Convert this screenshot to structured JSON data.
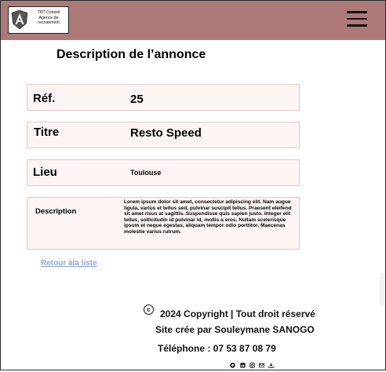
{
  "header": {
    "logo_text": "TRT Conseil Agence de recrutement"
  },
  "page_title": "Description de l’annonce",
  "details": {
    "ref_label": "Réf.",
    "ref_value": "25",
    "title_label": "Titre",
    "title_value": "Resto Speed",
    "location_label": "Lieu",
    "location_value": "Toulouse",
    "description_label": "Description",
    "description_value": "Lorem ipsum dolor sit amet, consectetur adipiscing elit. Nam augue  ligula, varius et tellus sed, pulvinar suscipit tellus. Praesent  eleifend sit amet risus at sagittis. Suspendisse quis sapien justo.  Integer elit tellus, sollicitudin id pulvinar id, mollis a eros. Nullam  scelerisque ipsum et neque egestas, aliquam tempor odio porttitor.  Maecenas molestie varius rutrum."
  },
  "back_link": "Retour àla liste",
  "footer": {
    "copyright": "2024 Copyright | Tout droit réservé",
    "credit": "Site crée par Souleymane SANOGO",
    "phone": "Téléphone : 07 53 87 08 79"
  },
  "colors": {
    "header_bg": "#ad7a78",
    "row_bg": "#fdf5f4",
    "link": "#8ea4d8"
  },
  "icons": [
    "github-icon",
    "linkedin-icon",
    "instagram-icon",
    "mail-icon",
    "download-icon"
  ]
}
